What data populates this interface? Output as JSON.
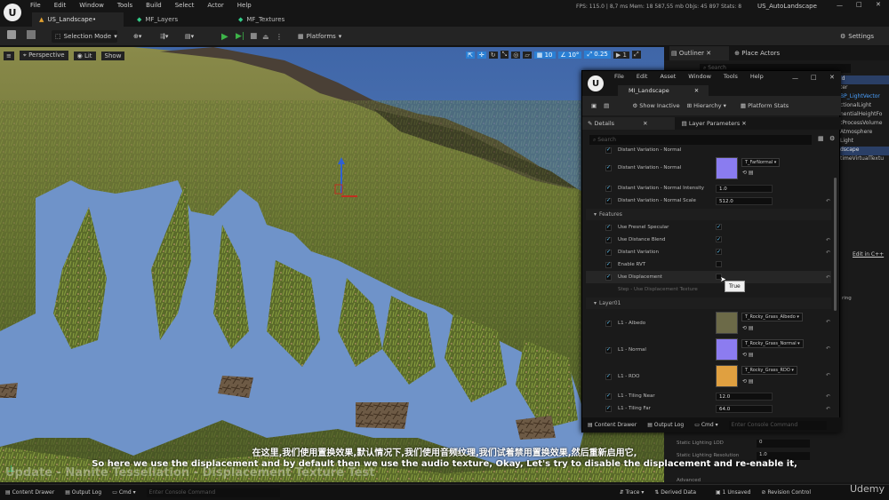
{
  "app": {
    "logo": "unreal-logo",
    "menu": [
      "File",
      "Edit",
      "Window",
      "Tools",
      "Build",
      "Select",
      "Actor",
      "Help"
    ],
    "tabs": [
      "US_Landscape•",
      "MF_Layers",
      "MF_Textures"
    ],
    "right_tab": "US_AutoLandscape",
    "stats": "FPS: 115.0 | 8,7 ms   Mem: 18 587,55 mb   Objs: 45 897   Stats: 8"
  },
  "toolbar": {
    "mode": "Selection Mode",
    "platforms": "Platforms",
    "settings": "Settings"
  },
  "viewport": {
    "perspective": "Perspective",
    "lit": "Lit",
    "show": "Show",
    "snap_grid": "10",
    "snap_rot": "10°",
    "snap_scale": "0.25",
    "cam_speed": "1",
    "title_overlay": "Update - Nanite Tessellation - Displacement Texture Test"
  },
  "material": {
    "title": "MI_Landscape",
    "show_inactive": "Show Inactive",
    "hierarchy": "Hierarchy",
    "platform_stats": "Platform Stats",
    "details_tab": "Details",
    "layer_params_tab": "Layer Parameters",
    "search_placeholder": "Search",
    "row_clipped": "Distant Variation - Normal",
    "p_dv_normal": "Distant Variation - Normal",
    "t_farnormal": "T_FarNormal",
    "p_dv_intensity": "Distant Variation - Normal Intensity",
    "v_intensity": "1.0",
    "p_dv_scale": "Distant Variation - Normal Scale",
    "v_scale": "512.0",
    "features": "Features",
    "f1": "Use Fresnel Specular",
    "f2": "Use Distance Blend",
    "f3": "Distant Variation",
    "f4": "Enable RVT",
    "f5": "Use Displacement",
    "f6": "Step - Use Displacement Texture",
    "tooltip": "True",
    "layer01": "Layer01",
    "l_albedo": "L1 - Albedo",
    "t_albedo": "T_Rocky_Grass_Albedo",
    "l_normal": "L1 - Normal",
    "t_normal": "T_Rocky_Grass_Normal",
    "l_rdo": "L1 - RDO",
    "t_rdo": "T_Rocky_Grass_RDO",
    "l_tnear": "L1 - Tiling Near",
    "v_tnear": "12.0",
    "l_tfar": "L1 - Tiling Far",
    "v_tfar": "64.0",
    "content_drawer": "Content Drawer",
    "output_log": "Output Log",
    "cmd": "Cmd",
    "console": "Enter Console Command"
  },
  "outliner": {
    "title": "Outliner",
    "place_actors": "Place Actors",
    "search": "Search",
    "items": [
      "ld",
      "ter",
      "BP_LightVector",
      "ctionalLight",
      "nentialHeightFo",
      "tProcessVolume",
      "Atmosphere",
      "Light",
      "dscape",
      "timeVirtualTextu"
    ],
    "edit_cpp": "Edit in C++",
    "ring": "ring",
    "static_lod": "Static Lighting LOD",
    "static_lod_val": "0",
    "static_res": "Static Lighting Resolution",
    "static_res_val": "1.0",
    "advanced": "Advanced"
  },
  "statusbar": {
    "content_drawer": "Content Drawer",
    "output_log": "Output Log",
    "cmd": "Cmd",
    "console": "Enter Console Command",
    "trace": "Trace",
    "derived": "Derived Data",
    "unsaved": "1 Unsaved",
    "revision": "Revision Control"
  },
  "subtitle": {
    "zh": "在这里,我们使用置换效果,默认情况下,我们使用音频纹理,我们试着禁用置换效果,然后重新启用它,",
    "en": "So here we use the displacement and by default then we use the audio texture, Okay, Let's try to disable the displacement and re-enable it,"
  },
  "watermark": "Udemy",
  "colors": {
    "accent": "#2a7fd4",
    "sky": "#6f93c9",
    "play": "#3db449"
  }
}
